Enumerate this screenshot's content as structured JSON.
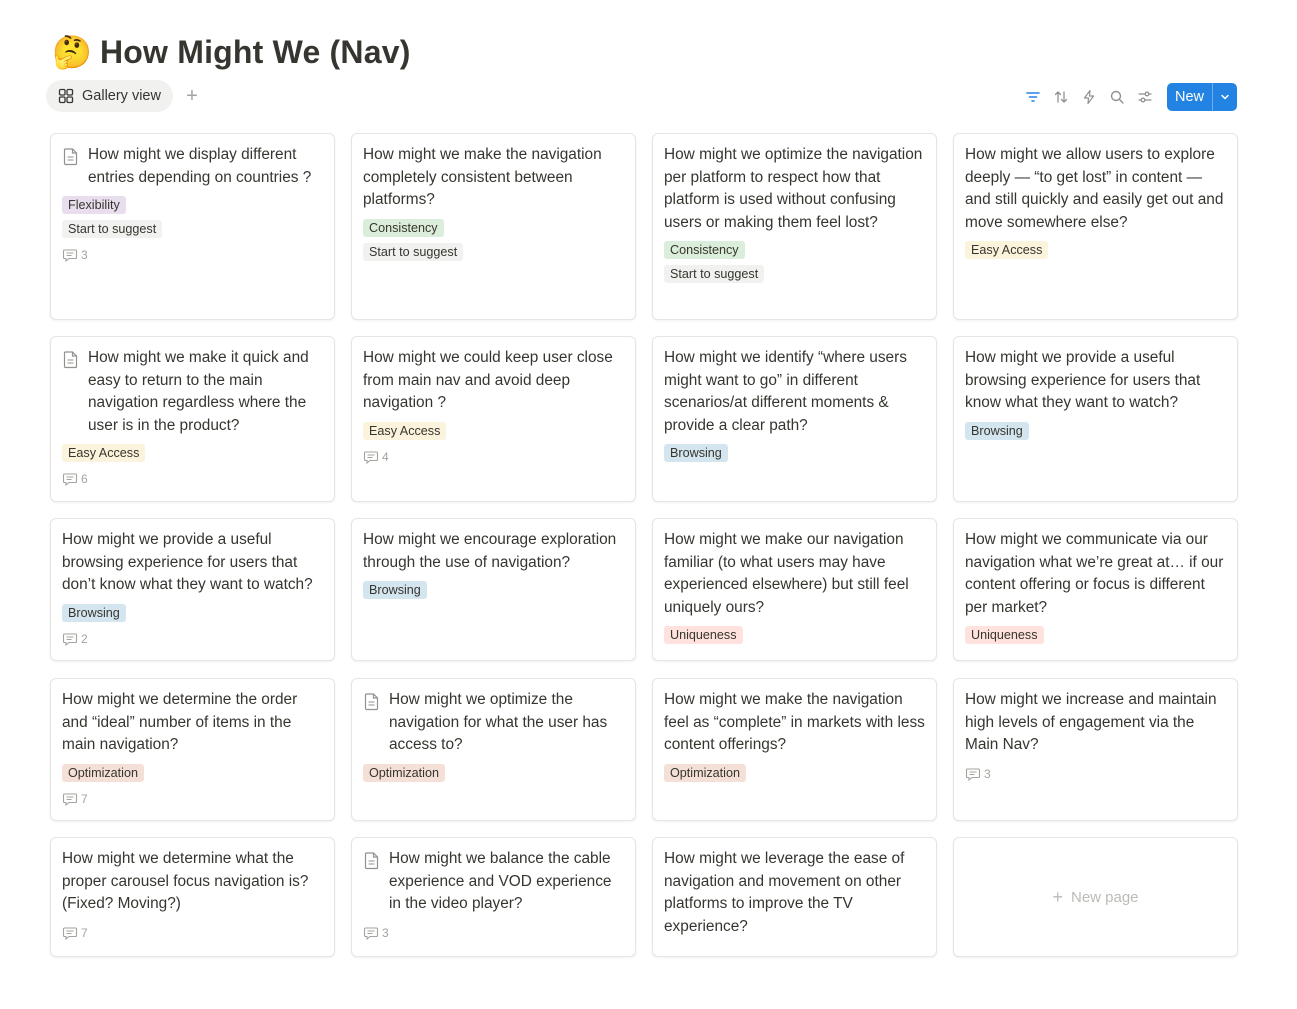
{
  "page": {
    "emoji": "🤔",
    "title": "How Might We (Nav)"
  },
  "views": {
    "active_label": "Gallery view",
    "add_label": "+"
  },
  "toolbar": {
    "new_label": "New"
  },
  "tag_colors": {
    "Flexibility": "#e8deee",
    "Consistency": "#dbeddb",
    "Easy Access": "#fbf3db",
    "Browsing": "#d3e5ef",
    "Uniqueness": "#ffe2dd",
    "Optimization": "#f5e0d8"
  },
  "cards": [
    {
      "title": "How might we display different entries depending on countries ?",
      "has_icon": true,
      "tag": "Flexibility",
      "status": "Start to suggest",
      "comments": "3"
    },
    {
      "title": "How might we make the navigation completely consistent between platforms?",
      "has_icon": false,
      "tag": "Consistency",
      "status": "Start to suggest",
      "comments": ""
    },
    {
      "title": "How might we optimize the navigation per platform to respect how that platform is used without confusing users or making them feel lost?",
      "has_icon": false,
      "tag": "Consistency",
      "status": "Start to suggest",
      "comments": ""
    },
    {
      "title": "How might we allow users to explore deeply — “to get lost” in content — and still quickly and easily get out and move somewhere else?",
      "has_icon": false,
      "tag": "Easy Access",
      "status": "",
      "comments": ""
    },
    {
      "title": "How might we make it quick and easy to return to the main navigation regardless where the user is in the product?",
      "has_icon": true,
      "tag": "Easy Access",
      "status": "",
      "comments": "6"
    },
    {
      "title": "How might we could keep user close from main nav and avoid deep navigation ?",
      "has_icon": false,
      "tag": "Easy Access",
      "status": "",
      "comments": "4"
    },
    {
      "title": "How might we identify “where users might want to go” in different scenarios/at different moments & provide a clear path?",
      "has_icon": false,
      "tag": "Browsing",
      "status": "",
      "comments": ""
    },
    {
      "title": "How might we provide a useful browsing experience for users that know what they want to watch?",
      "has_icon": false,
      "tag": "Browsing",
      "status": "",
      "comments": ""
    },
    {
      "title": "How might we provide a useful browsing experience for users that don’t know what they want to watch?",
      "has_icon": false,
      "tag": "Browsing",
      "status": "",
      "comments": "2"
    },
    {
      "title": "How might we encourage exploration through the use of navigation?",
      "has_icon": false,
      "tag": "Browsing",
      "status": "",
      "comments": ""
    },
    {
      "title": "How might we make our navigation familiar (to what users may have experienced elsewhere) but still feel uniquely ours?",
      "has_icon": false,
      "tag": "Uniqueness",
      "status": "",
      "comments": ""
    },
    {
      "title": "How might we communicate via our navigation what we’re great at… if our content offering or focus is different per market?",
      "has_icon": false,
      "tag": "Uniqueness",
      "status": "",
      "comments": ""
    },
    {
      "title": "How might we determine the order and “ideal” number of items in the main navigation?",
      "has_icon": false,
      "tag": "Optimization",
      "status": "",
      "comments": "7"
    },
    {
      "title": "How might we optimize the navigation for what the user has access to?",
      "has_icon": true,
      "tag": "Optimization",
      "status": "",
      "comments": ""
    },
    {
      "title": "How might we make the navigation feel as “complete” in markets with less content offerings?",
      "has_icon": false,
      "tag": "Optimization",
      "status": "",
      "comments": ""
    },
    {
      "title": "How might we increase and maintain high levels of engagement via the Main Nav?",
      "has_icon": false,
      "tag": "",
      "status": "",
      "comments": "3"
    },
    {
      "title": "How might we determine what the proper carousel focus navigation is? (Fixed? Moving?)",
      "has_icon": false,
      "tag": "",
      "status": "",
      "comments": "7"
    },
    {
      "title": "How might we balance the cable experience and VOD experience in the video player?",
      "has_icon": true,
      "tag": "",
      "status": "",
      "comments": "3"
    },
    {
      "title": "How might we leverage the ease of navigation and movement on other platforms to improve the TV experience?",
      "has_icon": false,
      "tag": "",
      "status": "",
      "comments": ""
    }
  ],
  "new_page": {
    "label": "New page",
    "plus": "+"
  }
}
